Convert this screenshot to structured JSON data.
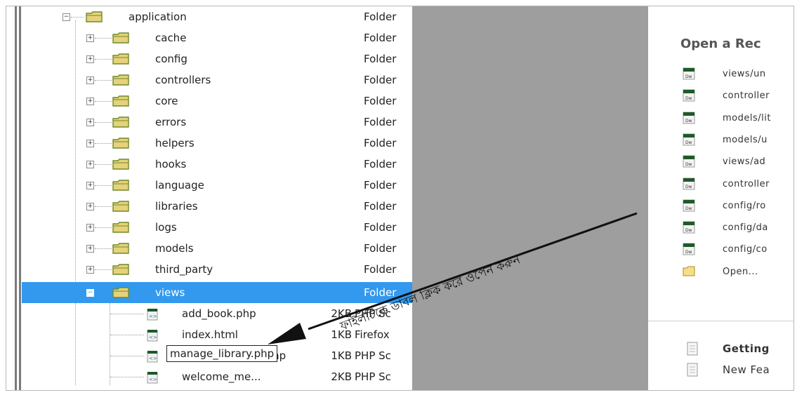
{
  "tree": {
    "root": {
      "name": "application",
      "type": "Folder"
    },
    "folders": [
      {
        "name": "cache",
        "type": "Folder"
      },
      {
        "name": "config",
        "type": "Folder"
      },
      {
        "name": "controllers",
        "type": "Folder"
      },
      {
        "name": "core",
        "type": "Folder"
      },
      {
        "name": "errors",
        "type": "Folder"
      },
      {
        "name": "helpers",
        "type": "Folder"
      },
      {
        "name": "hooks",
        "type": "Folder"
      },
      {
        "name": "language",
        "type": "Folder"
      },
      {
        "name": "libraries",
        "type": "Folder"
      },
      {
        "name": "logs",
        "type": "Folder"
      },
      {
        "name": "models",
        "type": "Folder"
      },
      {
        "name": "third_party",
        "type": "Folder"
      }
    ],
    "selected_folder": {
      "name": "views",
      "type": "Folder"
    },
    "files": [
      {
        "name": "add_book.php",
        "size": "2KB",
        "type": "PHP Sc"
      },
      {
        "name": "index.html",
        "size": "1KB",
        "type": "Firefox"
      },
      {
        "name": "manage_library.php",
        "size": "1KB",
        "type": "PHP Sc"
      },
      {
        "name": "welcome_me...",
        "size": "2KB",
        "type": "PHP Sc"
      }
    ]
  },
  "annotation": {
    "text": "ফাইলটিকে ডাবল ক্লিক করে ওপেন করুন"
  },
  "start_panel": {
    "title": "Open a Rec",
    "recent": [
      {
        "label": "views/un"
      },
      {
        "label": "controller"
      },
      {
        "label": "models/lit"
      },
      {
        "label": "models/u"
      },
      {
        "label": "views/ad"
      },
      {
        "label": "controller"
      },
      {
        "label": "config/ro"
      },
      {
        "label": "config/da"
      },
      {
        "label": "config/co"
      }
    ],
    "open_label": "Open...",
    "help": [
      {
        "label": "Getting",
        "bold": true
      },
      {
        "label": "New Fea",
        "bold": false
      }
    ]
  },
  "colors": {
    "selection": "#3399ee",
    "grey_panel": "#9e9e9e",
    "folder": "#d9c36a"
  }
}
